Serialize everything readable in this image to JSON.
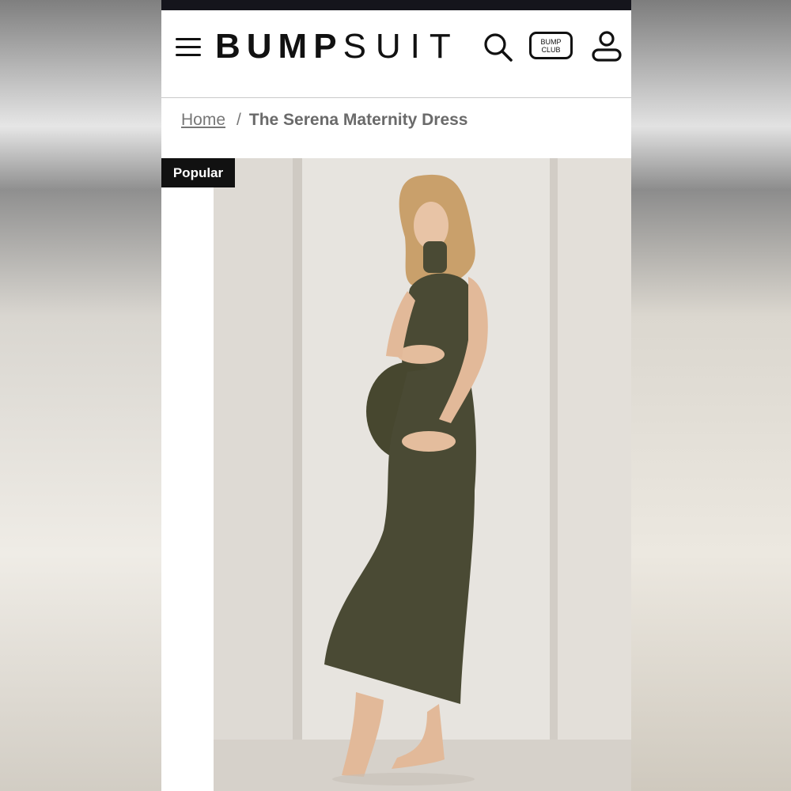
{
  "header": {
    "logo_bold": "BUMP",
    "logo_light": "SUIT",
    "club_badge_line1": "BUMP",
    "club_badge_line2": "CLUB"
  },
  "breadcrumb": {
    "home": "Home",
    "separator": "/",
    "current": "The Serena Maternity Dress"
  },
  "product": {
    "badge": "Popular"
  },
  "colors": {
    "topbar": "#15151c",
    "badge_bg": "#111111",
    "dress": "#4a4a34",
    "backdrop": "#e5e2dd"
  }
}
